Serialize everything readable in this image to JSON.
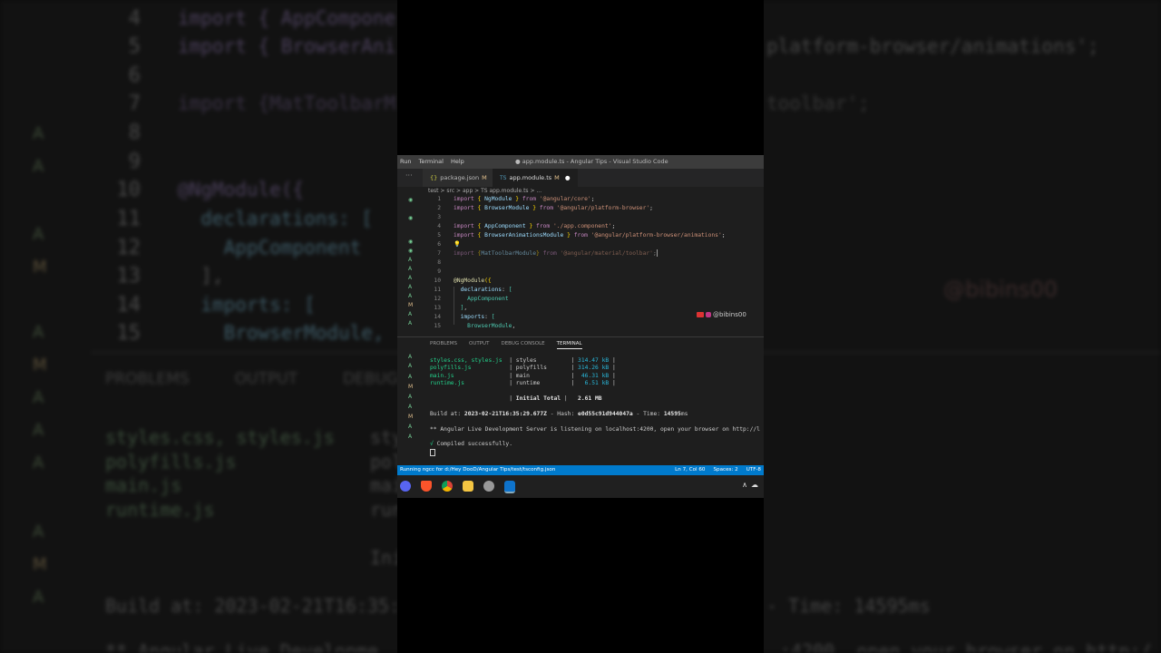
{
  "background": {
    "line_numbers": [
      "4",
      "5",
      "6",
      "7",
      "8",
      "9",
      "10",
      "11",
      "12",
      "13",
      "14",
      "15"
    ],
    "code_lines": [
      "import { AppCompone",
      "import { BrowserAni",
      "",
      "import {MatToolbarM",
      "",
      "",
      "@NgModule({",
      "  declarations: [",
      "    AppComponent",
      "  ],",
      "  imports: [",
      "    BrowserModule,"
    ],
    "right_fragments": [
      "platform-browser/animations';",
      "toolbar';"
    ],
    "scm_letters": [
      "A",
      "A",
      "A",
      "M",
      "A",
      "M",
      "A",
      "A",
      "A",
      "A",
      "M",
      "A"
    ],
    "panel_tabs": [
      "PROBLEMS",
      "OUTPUT",
      "DEBUG CO"
    ],
    "term_lines": [
      "styles.css, styles.js",
      "polyfills.js",
      "main.js",
      "runtime.js"
    ],
    "term_right": [
      "sty",
      "pol",
      "mai",
      "run"
    ],
    "initial": "Ini",
    "build_line": "Build at: 2023-02-21T16:35:",
    "time_line": "- Time: 14595ms",
    "angular_line": "** Angular Live Developme",
    "angular_right": ":4200, open your browser on http:/",
    "watermark": "@bibins00"
  },
  "window": {
    "menu": [
      "Run",
      "Terminal",
      "Help"
    ],
    "title": "● app.module.ts - Angular Tips - Visual Studio Code",
    "tabs": [
      {
        "label": "package.json",
        "status": "M"
      },
      {
        "label": "app.module.ts",
        "status": "M"
      }
    ],
    "breadcrumb": "test > src > app > TS app.module.ts > ...",
    "code": [
      {
        "n": "1",
        "t": "import { NgModule } from '@angular/core';"
      },
      {
        "n": "2",
        "t": "import { BrowserModule } from '@angular/platform-browser';"
      },
      {
        "n": "3",
        "t": ""
      },
      {
        "n": "4",
        "t": "import { AppComponent } from './app.component';"
      },
      {
        "n": "5",
        "t": "import { BrowserAnimationsModule } from '@angular/platform-browser/animations';"
      },
      {
        "n": "6",
        "t": ""
      },
      {
        "n": "7",
        "t": "import {MatToolbarModule} from '@angular/material/toolbar';"
      },
      {
        "n": "8",
        "t": ""
      },
      {
        "n": "9",
        "t": ""
      },
      {
        "n": "10",
        "t": "@NgModule({"
      },
      {
        "n": "11",
        "t": "  declarations: ["
      },
      {
        "n": "12",
        "t": "    AppComponent"
      },
      {
        "n": "13",
        "t": "  ],"
      },
      {
        "n": "14",
        "t": "  imports: ["
      },
      {
        "n": "15",
        "t": "    BrowserModule,"
      }
    ],
    "watermark": "@bibins00",
    "panel_tabs": [
      "PROBLEMS",
      "OUTPUT",
      "DEBUG CONSOLE",
      "TERMINAL"
    ],
    "active_panel_tab": "TERMINAL",
    "terminal": {
      "files": [
        {
          "file": "styles.css, styles.js",
          "name": "styles",
          "size": "314.47 kB"
        },
        {
          "file": "polyfills.js",
          "name": "polyfills",
          "size": "314.26 kB"
        },
        {
          "file": "main.js",
          "name": "main",
          "size": "46.31 kB"
        },
        {
          "file": "runtime.js",
          "name": "runtime",
          "size": "6.51 kB"
        }
      ],
      "total_label": "Initial Total",
      "total_size": "2.61 MB",
      "build_prefix": "Build at: ",
      "build_time": "2023-02-21T16:35:29.677Z",
      "hash_prefix": " - Hash: ",
      "hash": "e0d55c91d944047a",
      "time_prefix": " - Time: ",
      "time": "14595",
      "time_unit": "ms",
      "server_line": "** Angular Live Development Server is listening on localhost:4200, open your browser on http://l",
      "compiled_mark": "√",
      "compiled": " Compiled successfully."
    },
    "status": {
      "left": "Running ngcc for d:/Hey DooD/Angular Tips/test/tsconfig.json",
      "position": "Ln 7, Col 60",
      "spaces": "Spaces: 2",
      "encoding": "UTF-8"
    },
    "tray": [
      "∧",
      "☁"
    ]
  }
}
